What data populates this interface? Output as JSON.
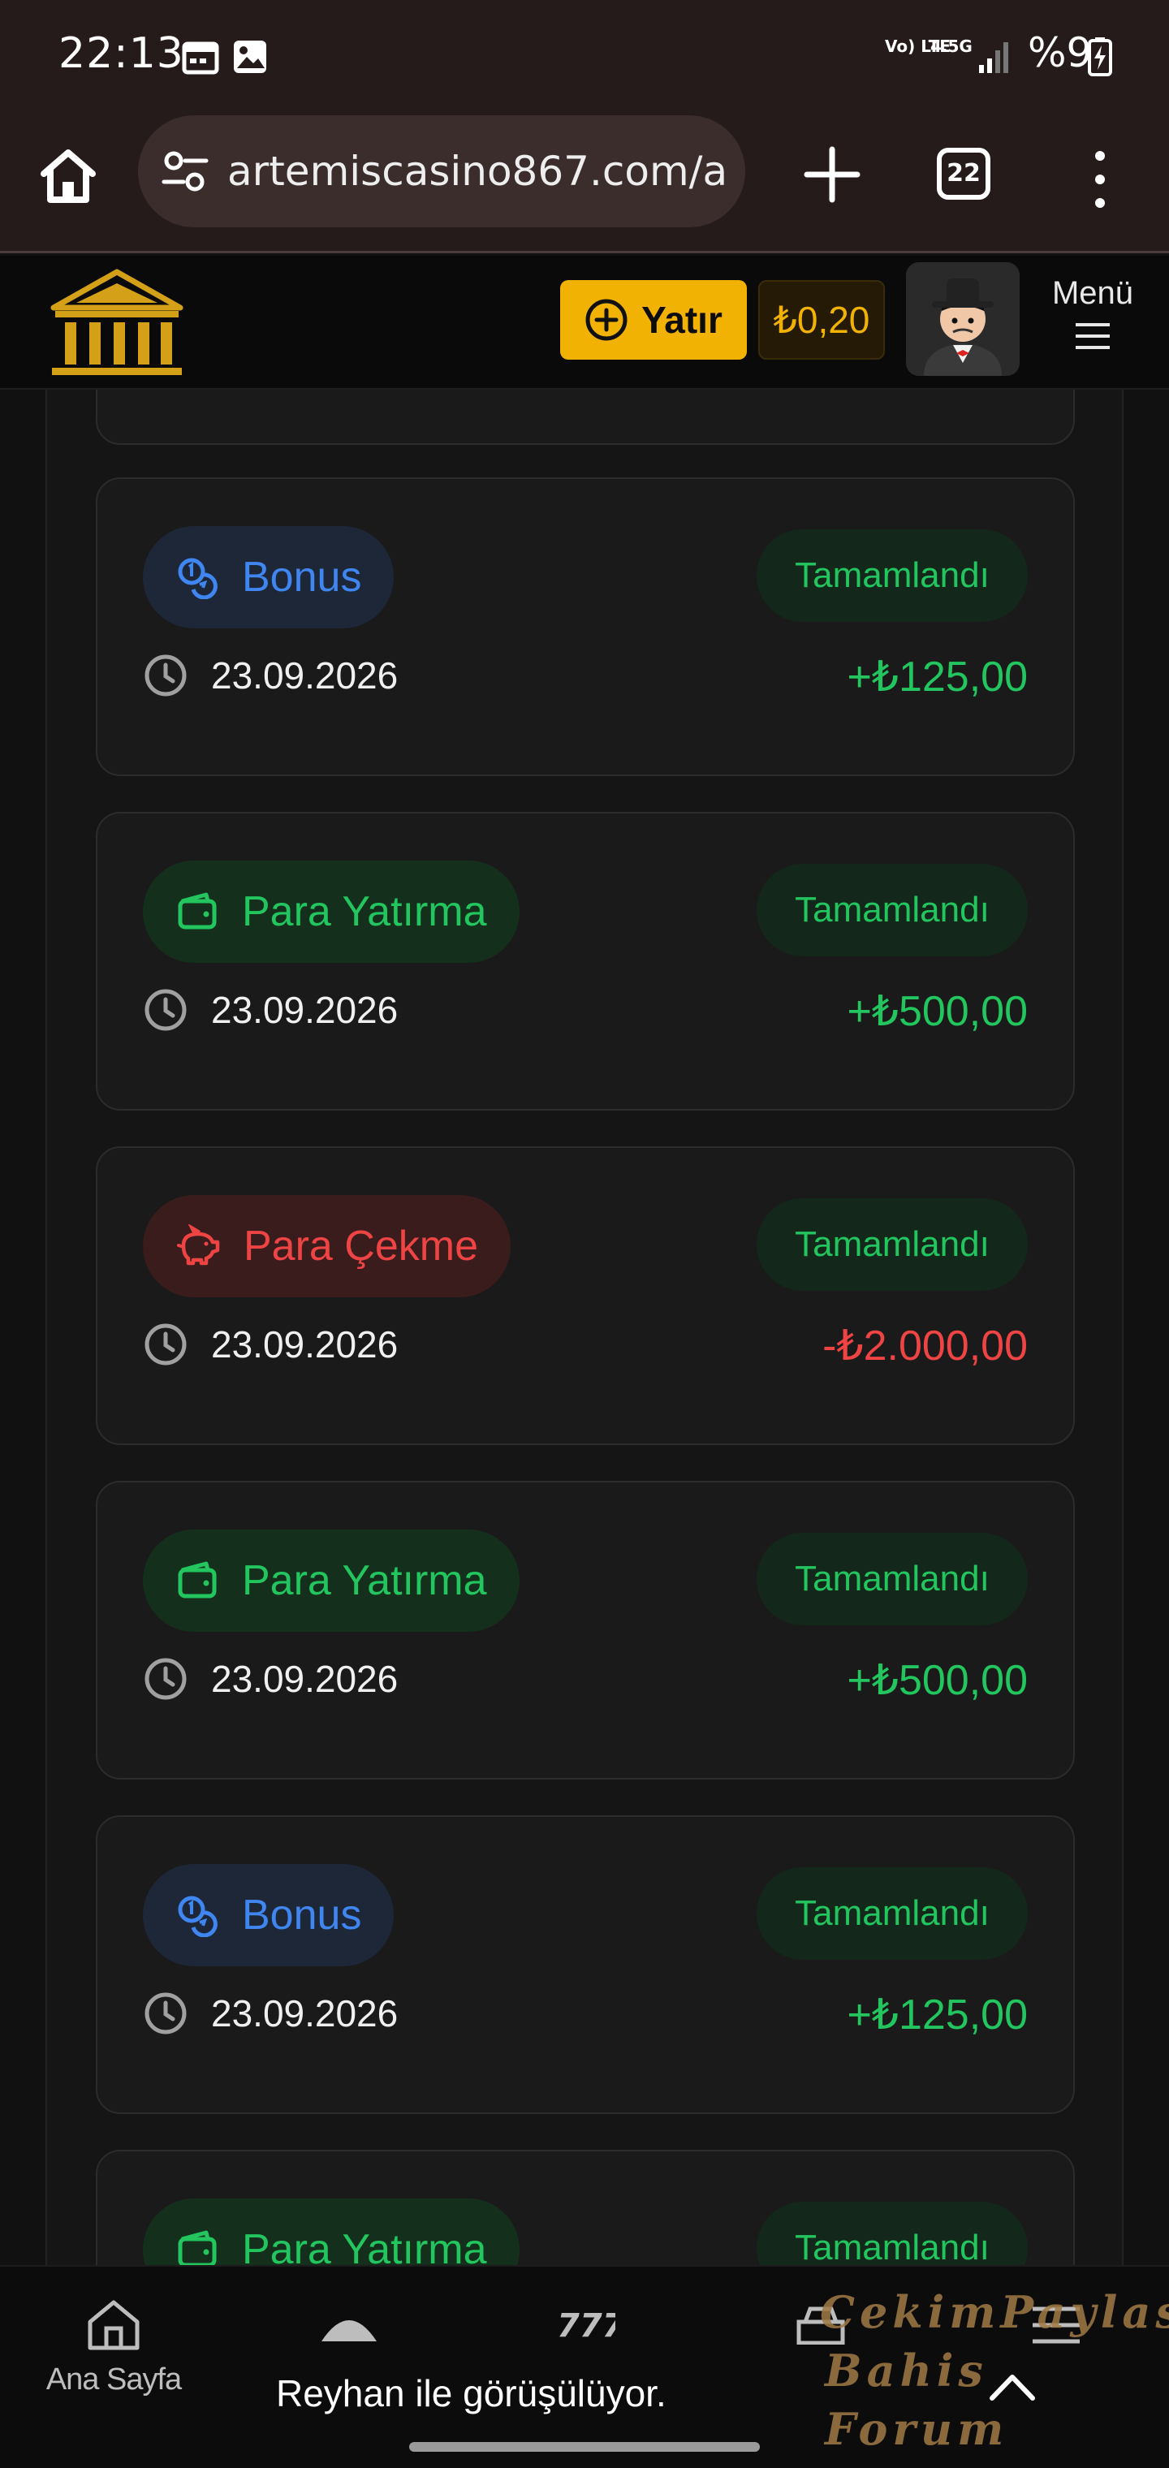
{
  "status_bar": {
    "time": "22:13",
    "network": "Vo) LTE",
    "network_type": "4.5G",
    "battery": "%9",
    "icons": [
      "calendar-icon",
      "image-icon",
      "signal-icon",
      "battery-charging-icon"
    ]
  },
  "browser": {
    "url": "artemiscasino867.com/a",
    "tab_count": "22"
  },
  "site_header": {
    "deposit_label": "Yatır",
    "balance": "₺0,20",
    "menu_label": "Menü",
    "accent_color": "#f2b203"
  },
  "transactions": [
    {
      "type": "Bonus",
      "kind": "bonus",
      "status": "Tamamlandı",
      "date": "23.09.2026",
      "amount": "+₺125,00"
    },
    {
      "type": "Para Yatırma",
      "kind": "deposit",
      "status": "Tamamlandı",
      "date": "23.09.2026",
      "amount": "+₺500,00"
    },
    {
      "type": "Para Çekme",
      "kind": "withdraw",
      "status": "Tamamlandı",
      "date": "23.09.2026",
      "amount": "-₺2.000,00"
    },
    {
      "type": "Para Yatırma",
      "kind": "deposit",
      "status": "Tamamlandı",
      "date": "23.09.2026",
      "amount": "+₺500,00"
    },
    {
      "type": "Bonus",
      "kind": "bonus",
      "status": "Tamamlandı",
      "date": "23.09.2026",
      "amount": "+₺125,00"
    },
    {
      "type": "Para Yatırma",
      "kind": "deposit",
      "status": "Tamamlandı",
      "date": "",
      "amount": ""
    }
  ],
  "colors": {
    "success": "#22c55e",
    "danger": "#ef4444",
    "bonus": "#3f86f0"
  },
  "bottom_nav": {
    "home_label": "Ana Sayfa",
    "toast": "Reyhan ile görüşülüyor.",
    "watermark_line1": "CekimPaylas",
    "watermark_line2": "Bahis Forum"
  }
}
